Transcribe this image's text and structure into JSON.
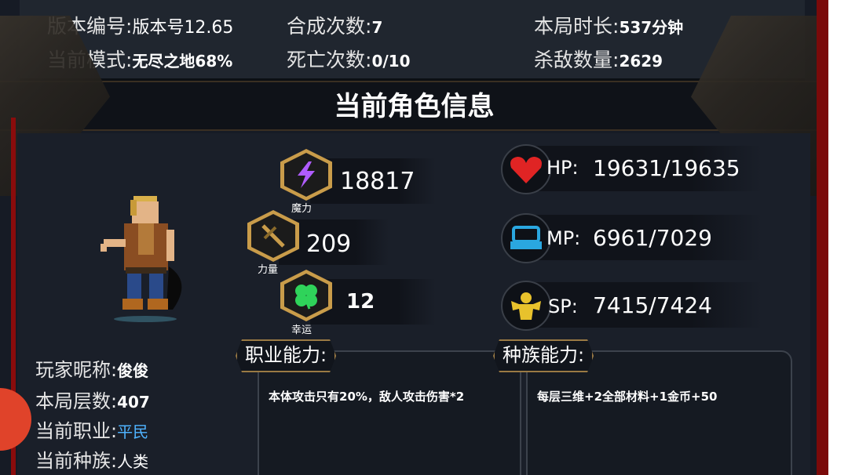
{
  "top_stats": {
    "version_label": "版本编号:",
    "version_value": "版本号12.65",
    "mode_label": "当前模式:",
    "mode_value": "无尽之地68%",
    "craft_label": "合成次数:",
    "craft_value": "7",
    "death_label": "死亡次数:",
    "death_value": "0/10",
    "duration_label": "本局时长:",
    "duration_value": "537分钟",
    "kills_label": "杀敌数量:",
    "kills_value": "2629"
  },
  "title": "当前角色信息",
  "attributes": [
    {
      "label": "魔力",
      "value": "18817",
      "icon": "lightning-icon",
      "color": "#b05cff"
    },
    {
      "label": "力量",
      "value": "209",
      "icon": "sword-icon",
      "color": "#c99c4a"
    },
    {
      "label": "幸运",
      "value": "12",
      "icon": "clover-icon",
      "color": "#2fd35a"
    }
  ],
  "vitals": [
    {
      "label": "HP:",
      "value": "19631/19635",
      "icon": "heart-icon",
      "color": "#e02424"
    },
    {
      "label": "MP:",
      "value": "6961/7029",
      "icon": "mana-icon",
      "color": "#2aa7e0"
    },
    {
      "label": "SP:",
      "value": "7415/7424",
      "icon": "strength-icon",
      "color": "#e8c22c"
    }
  ],
  "player": {
    "nickname_label": "玩家昵称:",
    "nickname": "俊俊",
    "floor_label": "本局层数:",
    "floor": "407",
    "class_label": "当前职业:",
    "class": "平民",
    "race_label": "当前种族:",
    "race": "人类"
  },
  "job_ability": {
    "label": "职业能力:",
    "text": "本体攻击只有20%，敌人攻击伤害*2"
  },
  "race_ability": {
    "label": "种族能力:",
    "text": "每层三维+2全部材料+1金币+50"
  }
}
